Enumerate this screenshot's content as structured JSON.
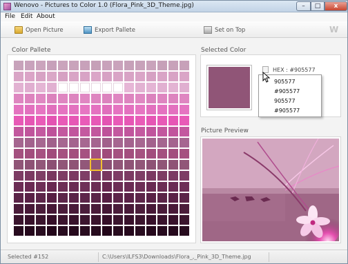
{
  "window": {
    "title": "Wenovo - Pictures to Color 1.0 (Flora_Pink_3D_Theme.jpg)",
    "min_label": "–",
    "max_label": "□",
    "close_label": "x"
  },
  "menu": {
    "items": [
      "File",
      "Edit",
      "About"
    ]
  },
  "toolbar": {
    "open_label": "Open Picture",
    "export_label": "Export Pallete",
    "ontop_label": "Set on Top",
    "logo": "W"
  },
  "palette": {
    "title": "Color Pallete",
    "rows": 16,
    "cols": 16,
    "selected_row": 9,
    "selected_col": 7,
    "row_colors": [
      [
        "#c8a3bb",
        "#c9a2bc",
        "#cba4bd",
        "#c7a0ba",
        "#caa4bc",
        "#c9a3bb",
        "#c8a1ba",
        "#c6a0b8",
        "#c9a2bb",
        "#caa3bc",
        "#c7a1b9",
        "#c8a2ba",
        "#c9a3bb",
        "#c6a0b8",
        "#c8a2ba",
        "#c7a1b9"
      ],
      [
        "#d9a5c6",
        "#dba4c7",
        "#d7a2c4",
        "#daa7c7",
        "#d6a1c3",
        "#d9a4c6",
        "#d8a3c5",
        "#dba6c8",
        "#d7a2c4",
        "#d9a4c6",
        "#d8a3c5",
        "#daa5c7",
        "#d6a1c3",
        "#d9a4c6",
        "#d8a3c5",
        "#daa5c7"
      ],
      [
        "#e2b2d2",
        "#e0aed0",
        "#e4b5d4",
        "#e1b0d1",
        "#ffffff",
        "#ffffff",
        "#ffffff",
        "#ffffff",
        "#ffffff",
        "#ffffff",
        "#e6b6d6",
        "#e2b2d2",
        "#e4b4d4",
        "#e1b0d1",
        "#e3b3d3",
        "#e0afd0"
      ],
      [
        "#de86c0",
        "#dd83be",
        "#e088c2",
        "#db82bd",
        "#df86c1",
        "#dd84bf",
        "#e087c2",
        "#de85c0",
        "#dc83be",
        "#df86c1",
        "#dd84bf",
        "#e088c2",
        "#db82bd",
        "#de85c0",
        "#dd84bf",
        "#df86c1"
      ],
      [
        "#e473c0",
        "#e270be",
        "#e676c2",
        "#e06fbc",
        "#e574c1",
        "#e371bf",
        "#e676c2",
        "#e472c0",
        "#e06fbc",
        "#e574c1",
        "#e371bf",
        "#e676c2",
        "#e270be",
        "#e472c0",
        "#e371bf",
        "#e574c1"
      ],
      [
        "#e759b6",
        "#e556b4",
        "#e95cb8",
        "#e354b2",
        "#e85ab7",
        "#e657b5",
        "#e95bb8",
        "#e759b6",
        "#e354b2",
        "#e85ab7",
        "#e657b5",
        "#e95cb8",
        "#e556b4",
        "#e759b6",
        "#e657b5",
        "#e85ab7"
      ],
      [
        "#c2579e",
        "#c0549c",
        "#c459a0",
        "#be529a",
        "#c3589f",
        "#c1559d",
        "#c459a0",
        "#c2579e",
        "#be529a",
        "#c3589f",
        "#c1559d",
        "#c459a0",
        "#c0549c",
        "#c2579e",
        "#c1559d",
        "#c3589f"
      ],
      [
        "#a5658f",
        "#a3628d",
        "#a76791",
        "#a1608b",
        "#a66690",
        "#a4638e",
        "#a76791",
        "#a5658f",
        "#a1608b",
        "#a66690",
        "#a4638e",
        "#a76791",
        "#a3628d",
        "#a5658f",
        "#a4638e",
        "#a66690"
      ],
      [
        "#a4507f",
        "#a24d7d",
        "#a65281",
        "#a04b7b",
        "#a55180",
        "#a34e7e",
        "#a65281",
        "#a4507f",
        "#a04b7b",
        "#a55180",
        "#a34e7e",
        "#a65281",
        "#a24d7d",
        "#a4507f",
        "#a34e7e",
        "#a55180"
      ],
      [
        "#905577",
        "#8e5275",
        "#925779",
        "#8c5073",
        "#915678",
        "#8f5376",
        "#925779",
        "#905577",
        "#8c5073",
        "#915678",
        "#8f5376",
        "#925779",
        "#8e5275",
        "#905577",
        "#8f5376",
        "#915678"
      ],
      [
        "#7d3c64",
        "#7b3962",
        "#7f3e66",
        "#793760",
        "#7e3d65",
        "#7c3a63",
        "#7f3e66",
        "#7d3c64",
        "#793760",
        "#7e3d65",
        "#7c3a63",
        "#7f3e66",
        "#7b3962",
        "#7d3c64",
        "#7c3a63",
        "#7e3d65"
      ],
      [
        "#6c2d55",
        "#6a2a53",
        "#6e2f57",
        "#682851",
        "#6d2e56",
        "#6b2b54",
        "#6e2f57",
        "#6c2d55",
        "#682851",
        "#6d2e56",
        "#6b2b54",
        "#6e2f57",
        "#6a2a53",
        "#6c2d55",
        "#6b2b54",
        "#6d2e56"
      ],
      [
        "#5b2448",
        "#592146",
        "#5d264a",
        "#571f44",
        "#5c2549",
        "#5a2247",
        "#5d264a",
        "#5b2448",
        "#571f44",
        "#5c2549",
        "#5a2247",
        "#5d264a",
        "#592146",
        "#5b2448",
        "#5a2247",
        "#5c2549"
      ],
      [
        "#4a1c3a",
        "#481938",
        "#4c1e3c",
        "#461736",
        "#4b1d3b",
        "#491a39",
        "#4c1e3c",
        "#4a1c3a",
        "#461736",
        "#4b1d3b",
        "#491a39",
        "#4c1e3c",
        "#481938",
        "#4a1c3a",
        "#491a39",
        "#4b1d3b"
      ],
      [
        "#3a142d",
        "#38112b",
        "#3c162f",
        "#360f29",
        "#3b152e",
        "#39122c",
        "#3c162f",
        "#3a142d",
        "#360f29",
        "#3b152e",
        "#39122c",
        "#3c162f",
        "#38112b",
        "#3a142d",
        "#39122c",
        "#3b152e"
      ],
      [
        "#270b1e",
        "#25081c",
        "#290d20",
        "#23061a",
        "#280c1f",
        "#26091d",
        "#290d20",
        "#270b1e",
        "#23061a",
        "#280c1f",
        "#26091d",
        "#290d20",
        "#25081c",
        "#270b1e",
        "#26091d",
        "#280c1f"
      ]
    ],
    "selected_border": "#f2c12e"
  },
  "selected": {
    "title": "Selected Color",
    "color": "#905577",
    "hex_label": "HEX : #905577"
  },
  "dropdown": {
    "items": [
      "905577",
      "#905577",
      "905577",
      "#905577"
    ]
  },
  "preview": {
    "title": "Picture Preview"
  },
  "status": {
    "selected_text": "Selected #152",
    "path_text": "C:\\Users\\ILFS3\\Downloads\\Flora_,_Pink_3D_Theme.jpg"
  }
}
